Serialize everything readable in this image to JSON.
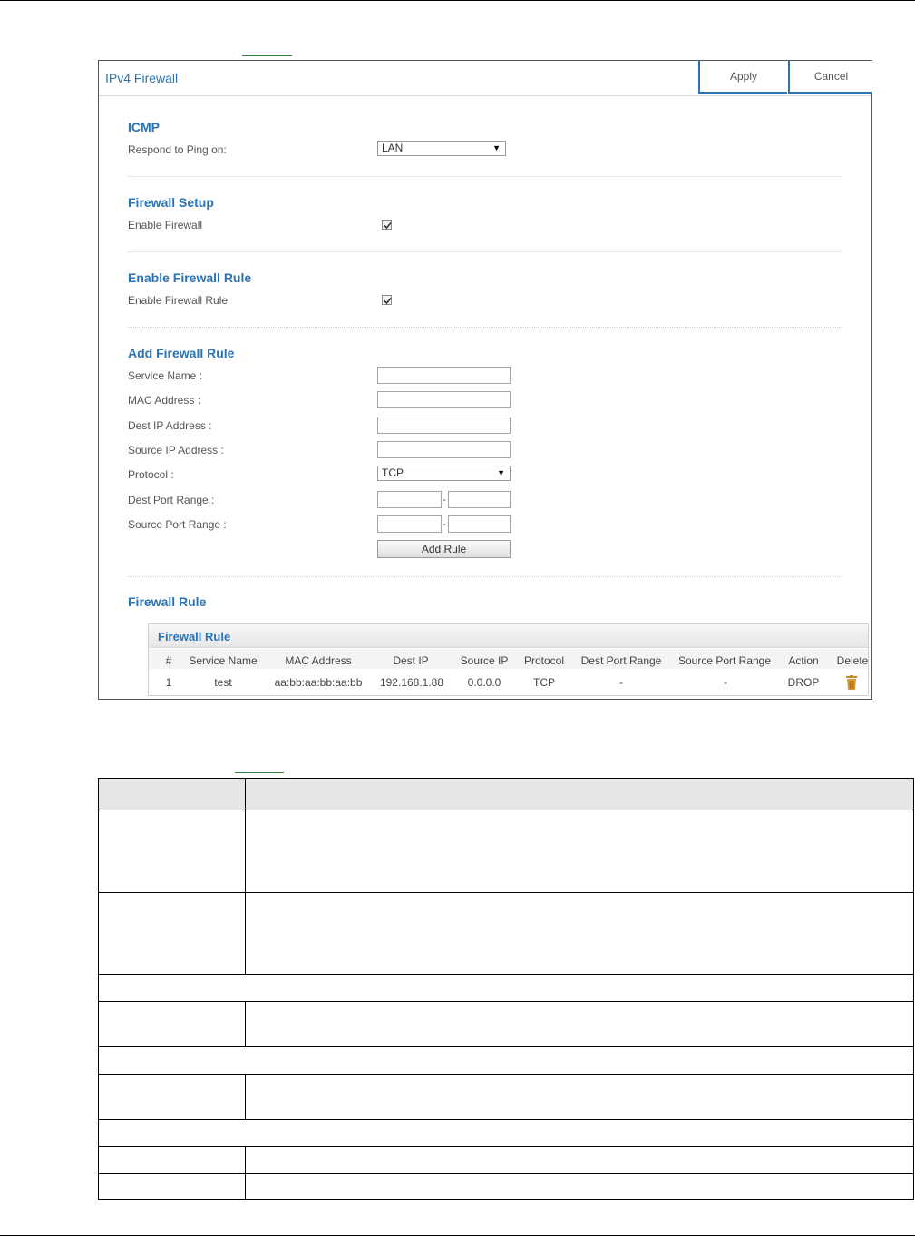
{
  "panel": {
    "title": "IPv4 Firewall",
    "apply_label": "Apply",
    "cancel_label": "Cancel"
  },
  "icmp": {
    "section_title": "ICMP",
    "ping_label": "Respond to Ping on:",
    "ping_value": "LAN"
  },
  "firewall_setup": {
    "section_title": "Firewall Setup",
    "enable_label": "Enable Firewall",
    "enable_checked": true
  },
  "enable_rule": {
    "section_title": "Enable Firewall Rule",
    "enable_label": "Enable Firewall Rule",
    "enable_checked": true
  },
  "add_rule": {
    "section_title": "Add Firewall Rule",
    "service_name_label": "Service Name :",
    "service_name_value": "",
    "mac_label": "MAC Address :",
    "mac_value": "",
    "dest_ip_label": "Dest IP Address :",
    "dest_ip_value": "",
    "source_ip_label": "Source IP Address :",
    "source_ip_value": "",
    "protocol_label": "Protocol :",
    "protocol_value": "TCP",
    "dest_port_label": "Dest Port Range :",
    "source_port_label": "Source Port Range :",
    "range_separator": "-",
    "add_button_label": "Add Rule"
  },
  "firewall_rule": {
    "section_title": "Firewall Rule",
    "table_title": "Firewall Rule",
    "columns": [
      "#",
      "Service Name",
      "MAC Address",
      "Dest IP",
      "Source IP",
      "Protocol",
      "Dest Port Range",
      "Source Port Range",
      "Action",
      "Delete"
    ],
    "rows": [
      [
        "1",
        "test",
        "aa:bb:aa:bb:aa:bb",
        "192.168.1.88",
        "0.0.0.0",
        "TCP",
        "-",
        "-",
        "DROP"
      ]
    ]
  },
  "icons": {
    "dropdown": "triangle-down-icon",
    "checkbox": "checkmark-icon",
    "delete": "trash-icon"
  },
  "colors": {
    "accent": "#2a74b5",
    "link_underline": "#2e8b3c",
    "table_header_bg": "#e6e6e6"
  }
}
